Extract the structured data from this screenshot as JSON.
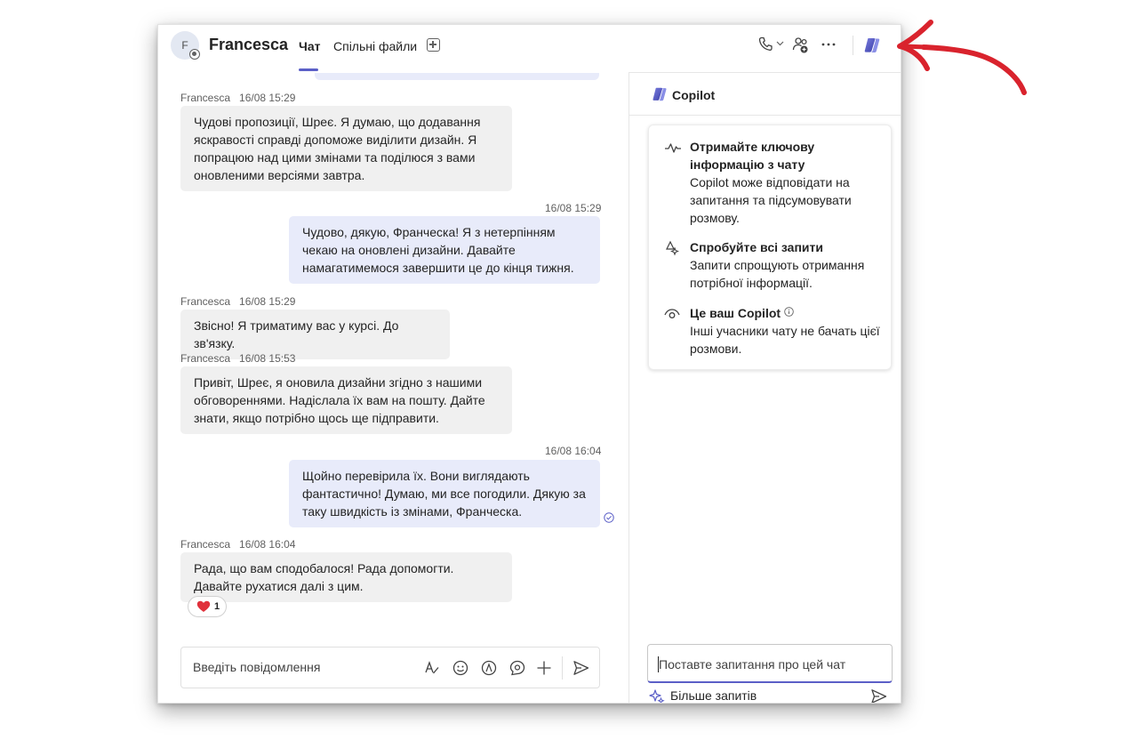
{
  "header": {
    "avatar_initial": "F",
    "contact_name": "Francesca",
    "tabs": [
      {
        "label": "Чат",
        "active": true
      },
      {
        "label": "Спільні файли",
        "active": false
      }
    ],
    "icons": [
      "add-tab-icon",
      "call-icon",
      "chevron-down-icon",
      "people-icon",
      "more-icon",
      "copilot-icon"
    ]
  },
  "chat": {
    "messages": [
      {
        "direction": "in",
        "sender": "Francesca",
        "time": "16/08 15:29",
        "text": "Чудові пропозиції, Шреє. Я думаю, що додавання яскравості справді допоможе виділити дизайн. Я попрацюю над цими змінами та поділюся з вами оновленими версіями завтра."
      },
      {
        "direction": "out",
        "time": "16/08 15:29",
        "text": "Чудово, дякую, Франческа! Я з нетерпінням чекаю на оновлені дизайни. Давайте намагатимемося завершити це до кінця тижня."
      },
      {
        "direction": "in",
        "sender": "Francesca",
        "time": "16/08 15:29",
        "text": "Звісно! Я триматиму вас у курсі. До зв'язку."
      },
      {
        "direction": "in",
        "sender": "Francesca",
        "time": "16/08 15:53",
        "text": "Привіт, Шреє, я оновила дизайни згідно з нашими обговореннями. Надіслала їх вам на пошту. Дайте знати, якщо потрібно щось ще підправити."
      },
      {
        "direction": "out",
        "time": "16/08 16:04",
        "text": "Щойно перевірила їх. Вони виглядають фантастично! Думаю, ми все погодили. Дякую за таку швидкість із змінами, Франческа."
      },
      {
        "direction": "in",
        "sender": "Francesca",
        "time": "16/08 16:04",
        "text": "Рада, що вам сподобалося! Рада допомогти. Давайте рухатися далі з цим."
      }
    ],
    "reaction": {
      "emoji": "heart",
      "count": "1"
    },
    "composer_placeholder": "Введіть повідомлення",
    "composer_tools": [
      "format-icon",
      "emoji-icon",
      "loop-icon",
      "sticker-icon",
      "attach-plus-icon",
      "send-icon"
    ]
  },
  "copilot": {
    "title": "Copilot",
    "items": [
      {
        "title": "Отримайте ключову інформацію з чату",
        "body": "Copilot може відповідати на запитання та підсумовувати розмову."
      },
      {
        "title": "Спробуйте всі запити",
        "body": "Запити спрощують отримання потрібної інформації."
      },
      {
        "title": "Це ваш Copilot",
        "body": "Інші учасники чату не бачать цієї розмови."
      }
    ],
    "input_placeholder": "Поставте запитання про цей чат",
    "more_prompts": "Більше запитів"
  },
  "colors": {
    "accent": "#5b5fc7",
    "outgoing_bubble": "#e8ebfa",
    "incoming_bubble": "#f0f0f0",
    "annotation_arrow": "#d9232d"
  }
}
